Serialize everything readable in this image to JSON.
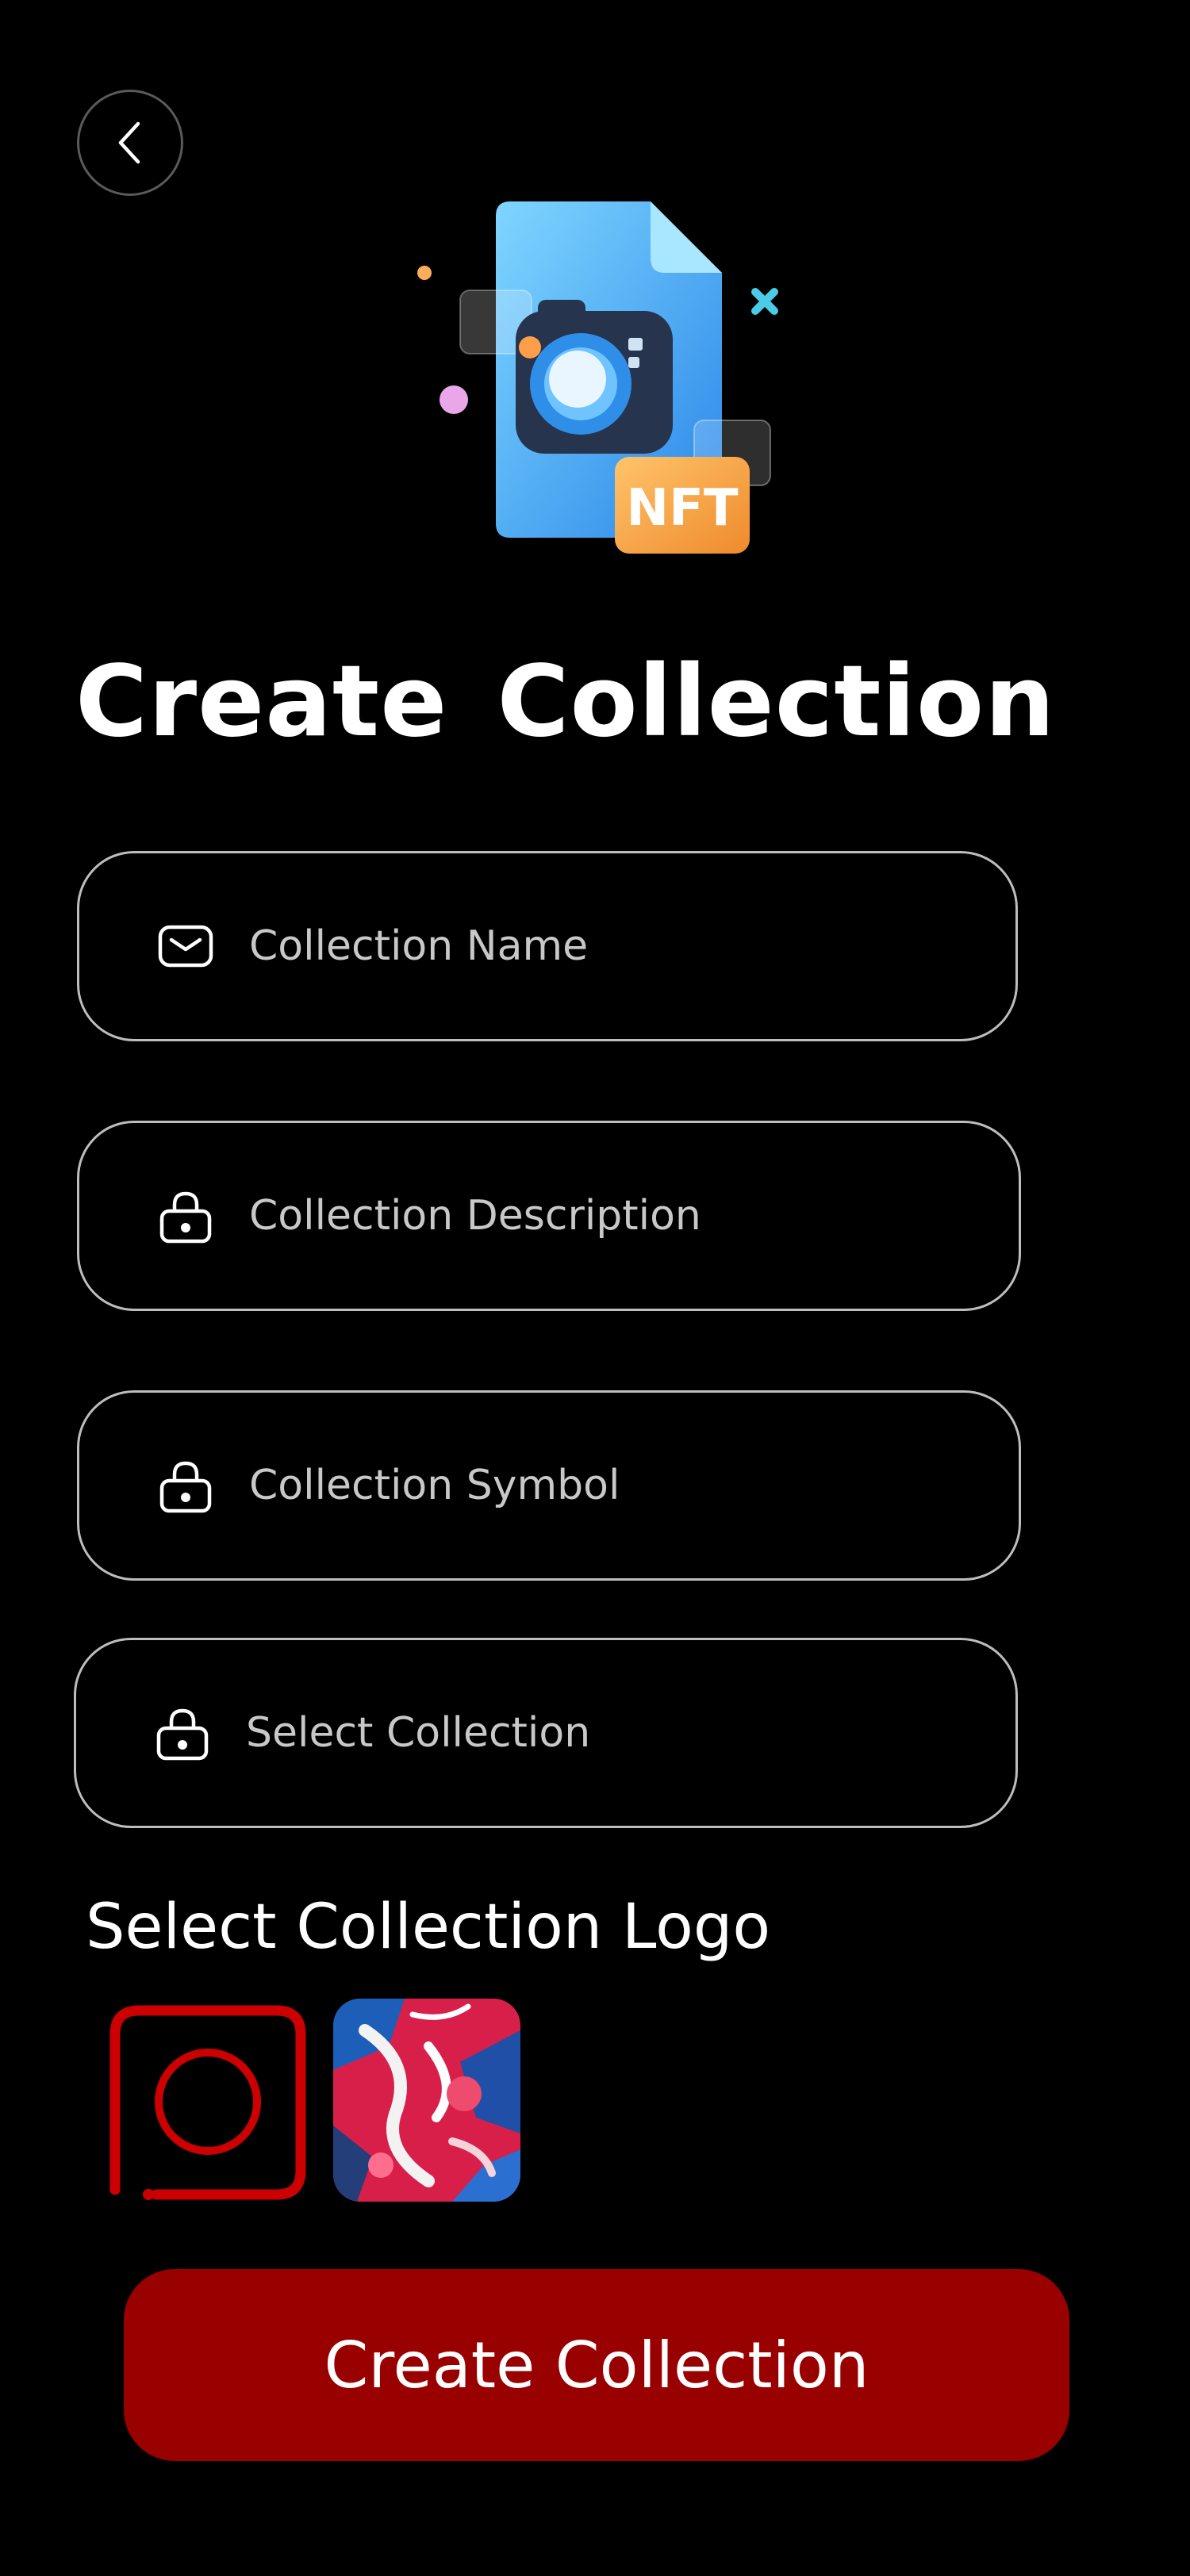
{
  "page": {
    "title": "Create Collection"
  },
  "form": {
    "fields": [
      {
        "placeholder": "Collection Name",
        "icon": "mail-icon",
        "value": ""
      },
      {
        "placeholder": "Collection Description",
        "icon": "lock-icon",
        "value": ""
      },
      {
        "placeholder": "Collection Symbol",
        "icon": "lock-icon",
        "value": ""
      },
      {
        "placeholder": "Select Collection",
        "icon": "lock-icon",
        "value": ""
      }
    ]
  },
  "logo_section": {
    "label": "Select Collection Logo",
    "upload_icon": "circle-upload-icon",
    "thumbnail_icon": "abstract-art-thumbnail"
  },
  "hero": {
    "badge_text": "NFT",
    "icon": "nft-camera-file-icon"
  },
  "actions": {
    "back_icon": "chevron-left-icon",
    "submit_label": "Create Collection"
  },
  "colors": {
    "background": "#000000",
    "accent": "#990000",
    "upload_outline": "#cc0000",
    "field_border": "#bdbdbd",
    "text": "#ffffff"
  }
}
